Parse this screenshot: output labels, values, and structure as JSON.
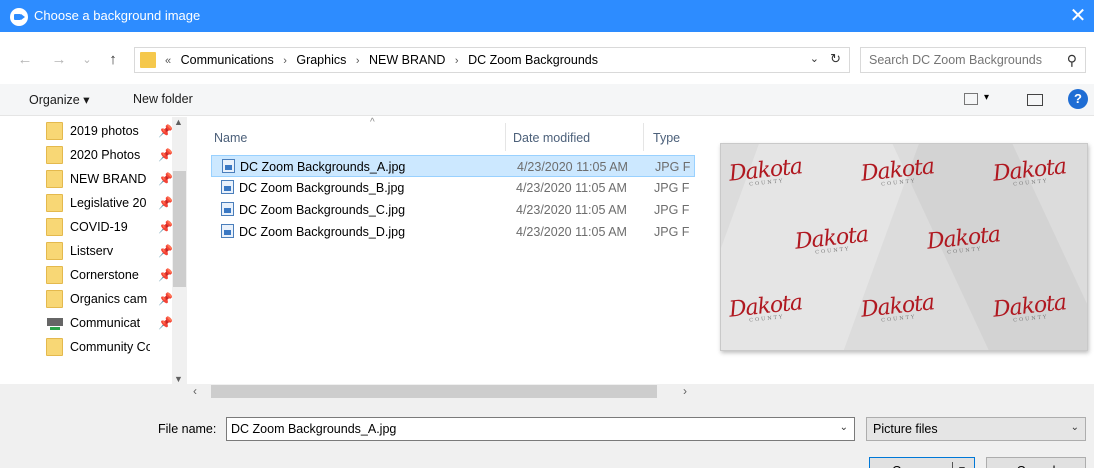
{
  "window": {
    "title": "Choose a background image",
    "close_glyph": "✕"
  },
  "nav": {
    "back_glyph": "←",
    "forward_glyph": "→",
    "recent_glyph": "⌄",
    "up_glyph": "↑"
  },
  "address": {
    "overflow": "«",
    "crumbs": [
      "Communications",
      "Graphics",
      "NEW BRAND",
      "DC Zoom Backgrounds"
    ],
    "separator": "›"
  },
  "search": {
    "placeholder": "Search DC Zoom Backgrounds"
  },
  "toolbar": {
    "organize_label": "Organize ▾",
    "new_folder_label": "New folder",
    "help_label": "?"
  },
  "sidebar": {
    "items": [
      {
        "label": "2019 photos",
        "icon": "folder-icon"
      },
      {
        "label": "2020 Photos",
        "icon": "folder-icon"
      },
      {
        "label": "NEW BRAND",
        "icon": "folder-icon"
      },
      {
        "label": "Legislative 20",
        "icon": "folder-icon"
      },
      {
        "label": "COVID-19",
        "icon": "folder-icon"
      },
      {
        "label": "Listserv",
        "icon": "folder-icon"
      },
      {
        "label": "Cornerstone",
        "icon": "folder-icon"
      },
      {
        "label": "Organics cam",
        "icon": "folder-icon"
      },
      {
        "label": "Communicat",
        "icon": "network-drive-icon"
      },
      {
        "label": "Community Cor",
        "icon": "folder-icon"
      }
    ]
  },
  "file_list": {
    "columns": {
      "name": "Name",
      "date": "Date modified",
      "type": "Type"
    },
    "rows": [
      {
        "name": "DC Zoom Backgrounds_A.jpg",
        "date": "4/23/2020 11:05 AM",
        "type": "JPG F"
      },
      {
        "name": "DC Zoom Backgrounds_B.jpg",
        "date": "4/23/2020 11:05 AM",
        "type": "JPG F"
      },
      {
        "name": "DC Zoom Backgrounds_C.jpg",
        "date": "4/23/2020 11:05 AM",
        "type": "JPG F"
      },
      {
        "name": "DC Zoom Backgrounds_D.jpg",
        "date": "4/23/2020 11:05 AM",
        "type": "JPG F"
      }
    ]
  },
  "preview": {
    "logo_text": "Dakota",
    "logo_sub": "COUNTY"
  },
  "bottom": {
    "file_name_label": "File name:",
    "file_name_value": "DC Zoom Backgrounds_A.jpg",
    "file_type_value": "Picture files",
    "open_label": "Open",
    "cancel_label": "Cancel"
  },
  "colors": {
    "titlebar": "#2d8cff",
    "selection": "#cce8ff",
    "logo_red": "#b01820"
  }
}
